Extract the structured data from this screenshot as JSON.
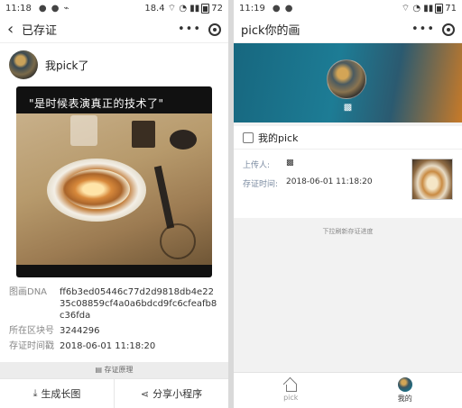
{
  "left": {
    "status": {
      "time": "11:18",
      "icons": "● ● ⌁",
      "right": "18.4",
      "battery": "72"
    },
    "nav": {
      "title": "已存证"
    },
    "user": {
      "name": "我pick了"
    },
    "card": {
      "quote": "\"是时候表演真正的技术了\""
    },
    "meta": [
      {
        "label": "图画DNA",
        "value": "ff6b3ed05446c77d2d9818db4e2235c08859cf4a0a6bdcd9fc6cfeafb8c36fda"
      },
      {
        "label": "所在区块号",
        "value": "3244296"
      },
      {
        "label": "存证时间戳",
        "value": "2018-06-01 11:18:20"
      }
    ],
    "verify_label": "存证原理",
    "bottom": {
      "save_long": "生成长图",
      "share": "分享小程序"
    }
  },
  "right": {
    "status": {
      "time": "11:19",
      "icons": "● ●",
      "right": "",
      "battery": "71"
    },
    "nav": {
      "title": "pick你的画"
    },
    "banner": {
      "name": "▩"
    },
    "section": {
      "title": "我的pick"
    },
    "info": [
      {
        "label": "上传人:",
        "value": "▩"
      },
      {
        "label": "存证时间:",
        "value": "2018-06-01 11:18:20"
      }
    ],
    "hint": "下拉刷新存证进度",
    "tabs": [
      {
        "label": "pick",
        "active": false
      },
      {
        "label": "我的",
        "active": true
      }
    ]
  }
}
